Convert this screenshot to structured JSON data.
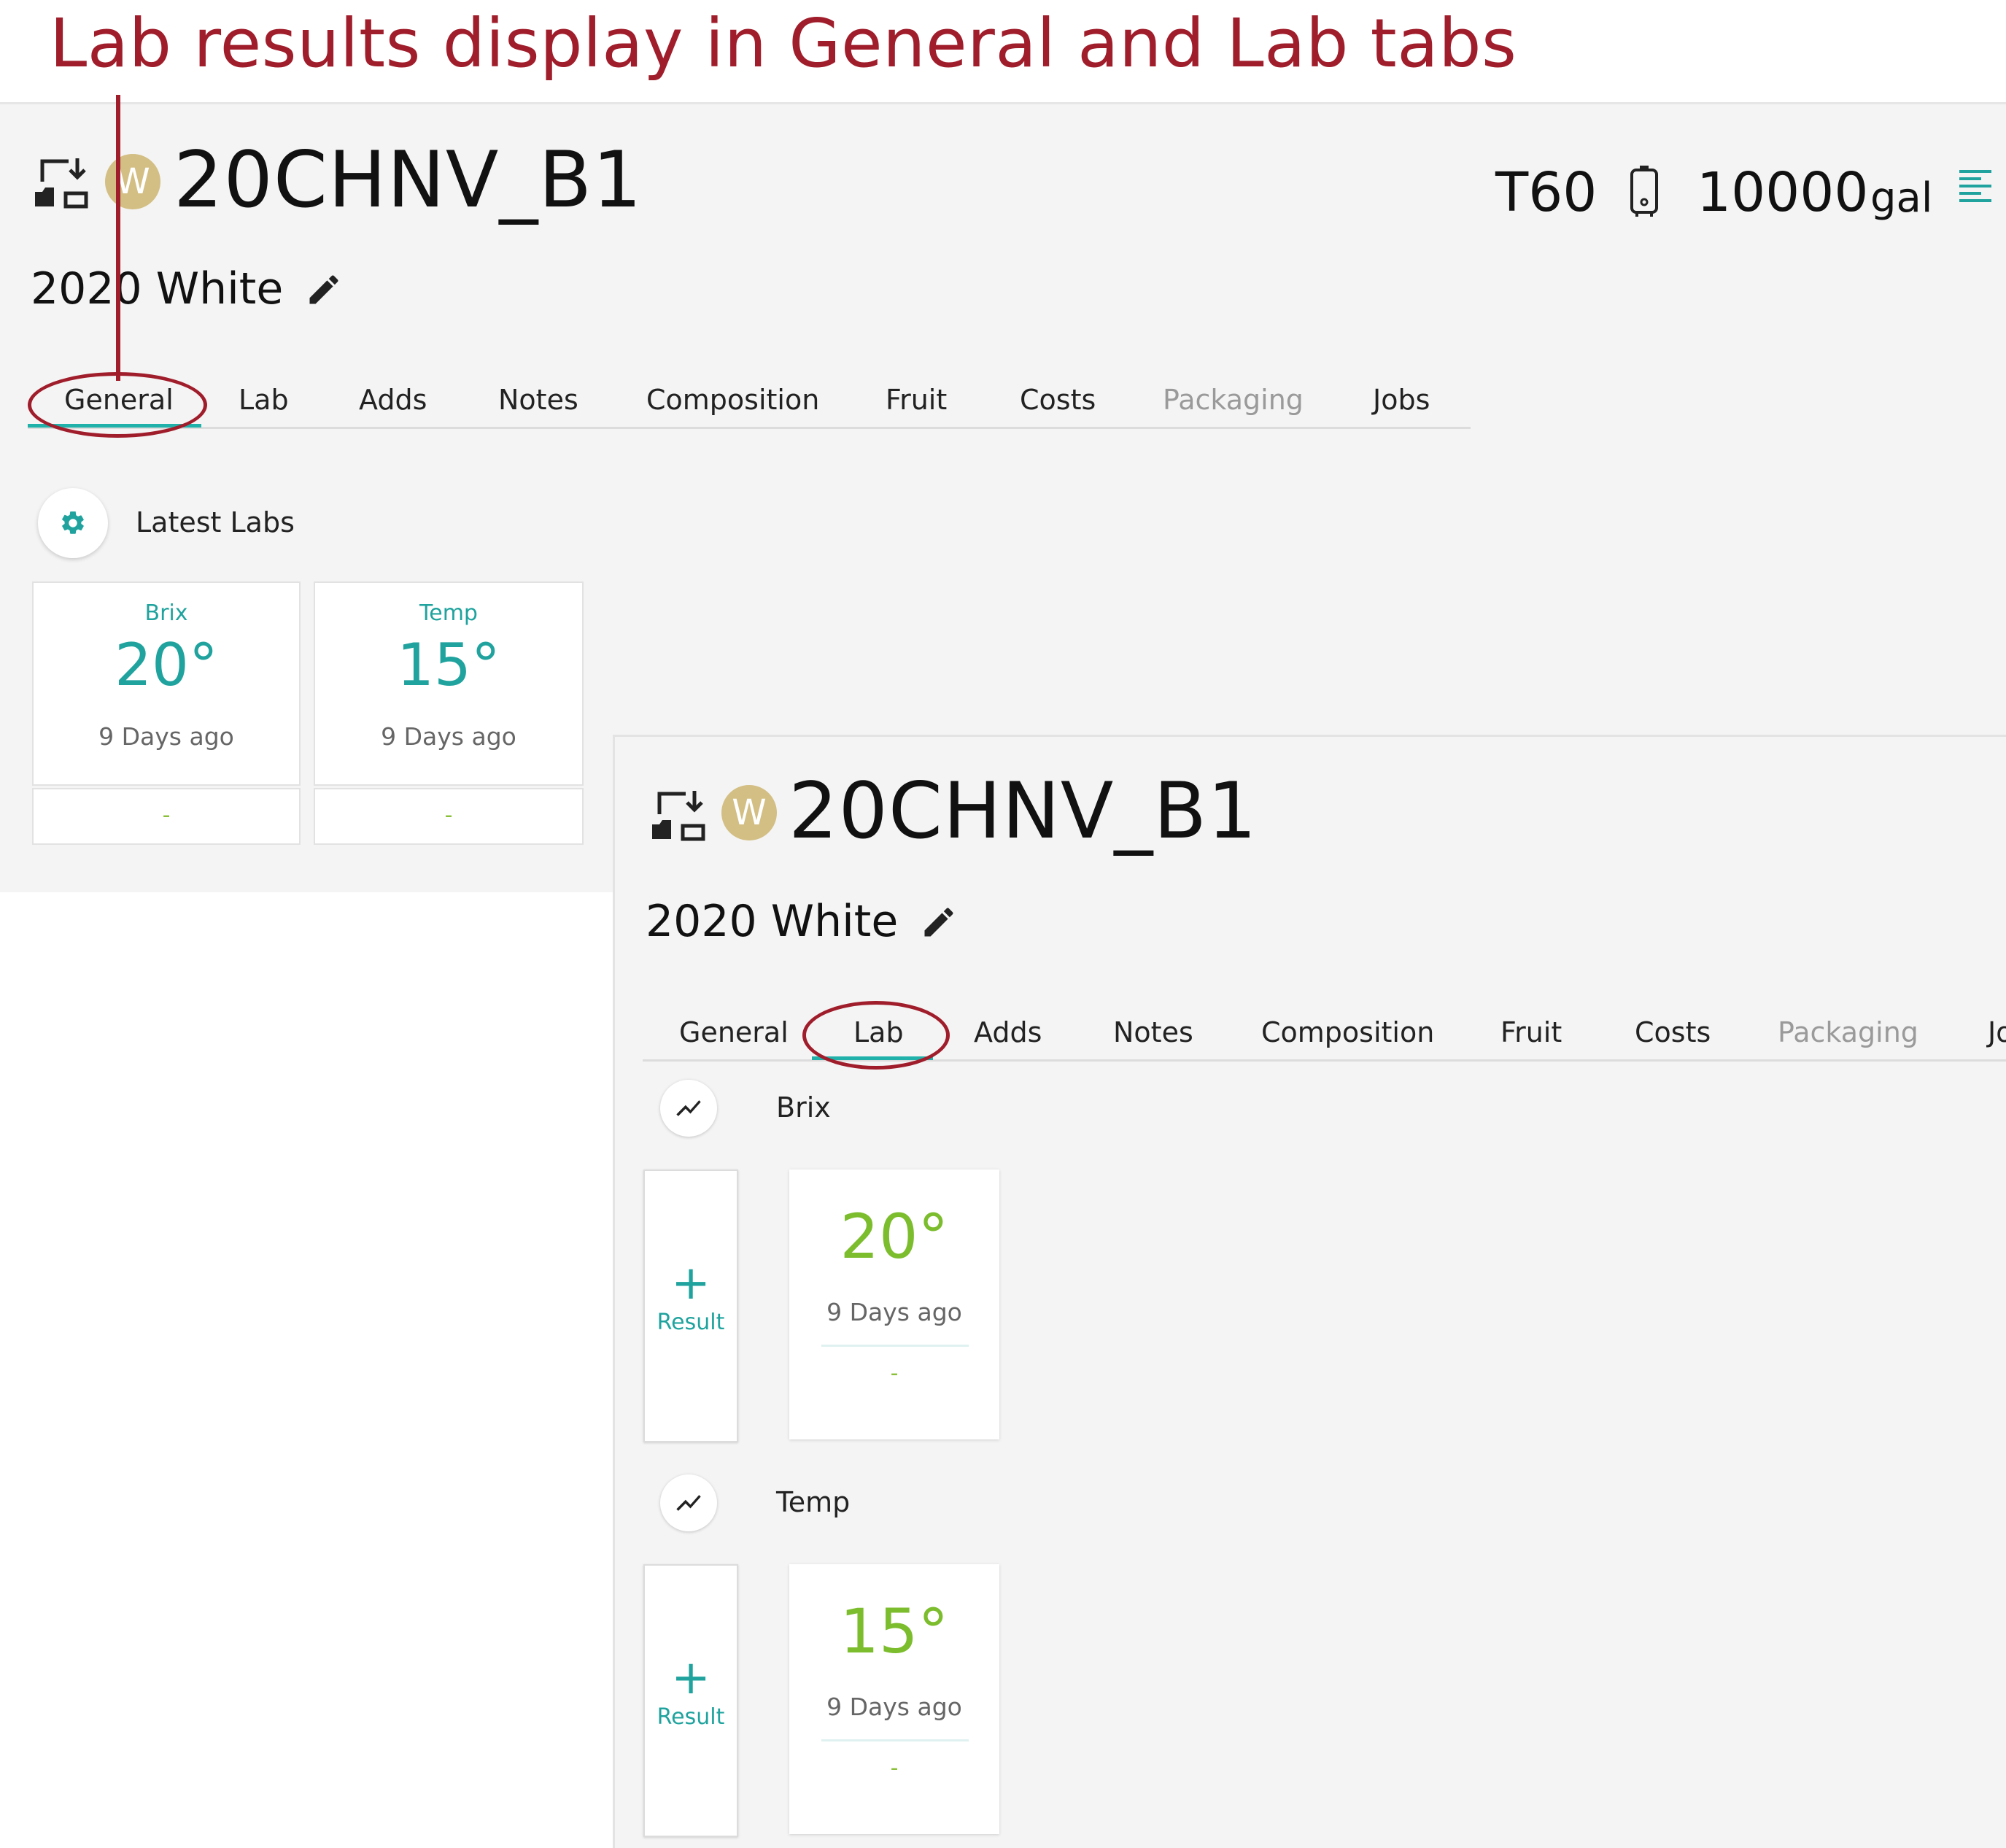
{
  "annotation": {
    "title": "Lab results display in General and Lab tabs"
  },
  "batch": {
    "name": "20CHNV_B1",
    "avatar_letter": "W",
    "description": "2020 White",
    "tank": "T60",
    "volume": "10000",
    "volume_unit": "gal"
  },
  "tabs": [
    {
      "label": "General",
      "disabled": false
    },
    {
      "label": "Lab",
      "disabled": false
    },
    {
      "label": "Adds",
      "disabled": false
    },
    {
      "label": "Notes",
      "disabled": false
    },
    {
      "label": "Composition",
      "disabled": false
    },
    {
      "label": "Fruit",
      "disabled": false
    },
    {
      "label": "Costs",
      "disabled": false
    },
    {
      "label": "Packaging",
      "disabled": true
    },
    {
      "label": "Jobs",
      "disabled": false
    }
  ],
  "general_tab": {
    "section_title": "Latest Labs",
    "cards": [
      {
        "label": "Brix",
        "value": "20°",
        "time": "9 Days ago",
        "footer": "-"
      },
      {
        "label": "Temp",
        "value": "15°",
        "time": "9 Days ago",
        "footer": "-"
      }
    ]
  },
  "lab_tab": {
    "add_label": "Result",
    "add_symbol": "+",
    "sections": [
      {
        "title": "Brix",
        "value": "20°",
        "time": "9 Days ago",
        "footer": "-"
      },
      {
        "title": "Temp",
        "value": "15°",
        "time": "9 Days ago",
        "footer": "-"
      }
    ],
    "partial_tab_label": "Jo"
  },
  "colors": {
    "accent": "#20a39e",
    "annotation": "#a01d2b",
    "value_green": "#7cbd2e",
    "avatar": "#d3bf84"
  }
}
